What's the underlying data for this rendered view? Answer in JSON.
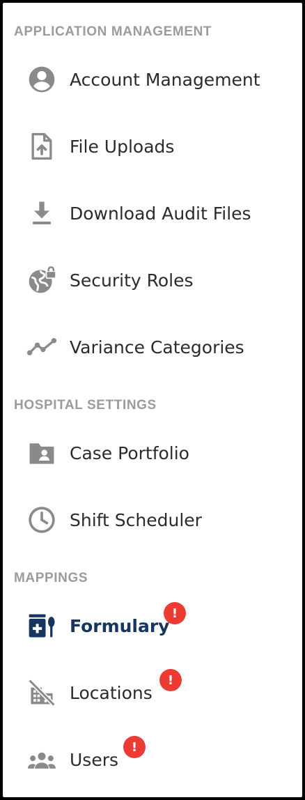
{
  "sections": [
    {
      "title": "APPLICATION MANAGEMENT",
      "items": [
        {
          "label": "Account Management",
          "icon": "account-circle-icon"
        },
        {
          "label": "File Uploads",
          "icon": "file-upload-icon"
        },
        {
          "label": "Download Audit Files",
          "icon": "download-icon"
        },
        {
          "label": "Security Roles",
          "icon": "globe-lock-icon"
        },
        {
          "label": "Variance Categories",
          "icon": "trend-line-icon"
        }
      ]
    },
    {
      "title": "HOSPITAL SETTINGS",
      "items": [
        {
          "label": "Case Portfolio",
          "icon": "folder-user-icon"
        },
        {
          "label": "Shift Scheduler",
          "icon": "clock-icon"
        }
      ]
    },
    {
      "title": "MAPPINGS",
      "items": [
        {
          "label": "Formulary",
          "icon": "formulary-icon",
          "active": true,
          "badge": "!"
        },
        {
          "label": "Locations",
          "icon": "building-off-icon",
          "badge": "!"
        },
        {
          "label": "Users",
          "icon": "group-icon",
          "badge": "!"
        }
      ]
    }
  ],
  "colors": {
    "text": "#2b2b2b",
    "icon": "#8a8a8a",
    "active": "#16365f",
    "section_title": "#9b9b9b",
    "badge": "#ec3b33"
  }
}
